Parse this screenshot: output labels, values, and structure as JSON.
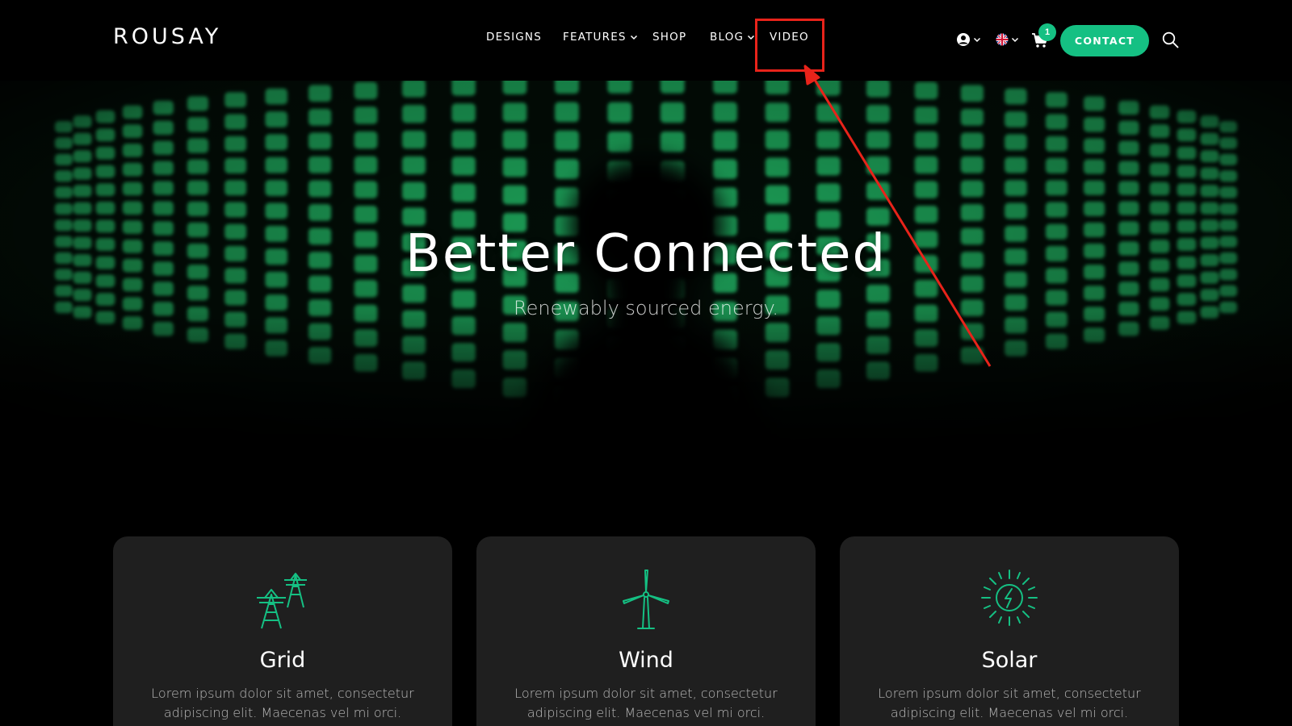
{
  "header": {
    "logo": "ROUSAY",
    "nav": [
      {
        "label": "DESIGNS"
      },
      {
        "label": "FEATURES"
      },
      {
        "label": "SHOP"
      },
      {
        "label": "BLOG"
      },
      {
        "label": "VIDEO"
      }
    ],
    "cart_count": "1",
    "contact_label": "CONTACT"
  },
  "hero": {
    "title": "Better Connected",
    "subtitle": "Renewably sourced energy."
  },
  "cards": [
    {
      "title": "Grid",
      "text": "Lorem ipsum dolor sit amet, consectetur adipiscing elit. Maecenas vel mi orci.",
      "icon": "power-grid-icon"
    },
    {
      "title": "Wind",
      "text": "Lorem ipsum dolor sit amet, consectetur adipiscing elit. Maecenas vel mi orci.",
      "icon": "wind-turbine-icon"
    },
    {
      "title": "Solar",
      "text": "Lorem ipsum dolor sit amet, consectetur adipiscing elit. Maecenas vel mi orci.",
      "icon": "solar-sun-icon"
    }
  ],
  "colors": {
    "accent": "#15c083",
    "hero_green": "#1fa85c",
    "annotation": "#e8231a",
    "card_bg": "#1f1f1f"
  }
}
